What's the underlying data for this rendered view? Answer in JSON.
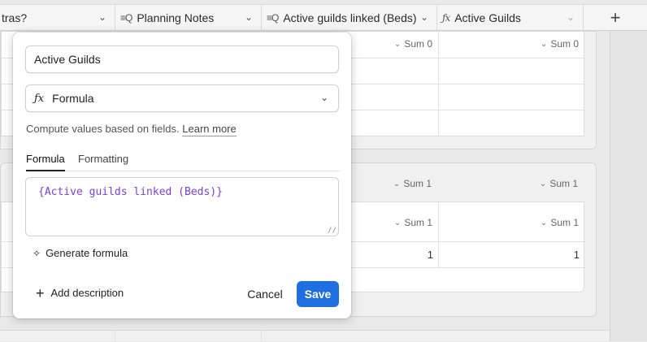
{
  "header": {
    "columns": [
      {
        "label": "tras?",
        "icon": "chevron-down-icon"
      },
      {
        "label": "Planning Notes",
        "icon": "lookup-icon"
      },
      {
        "label": "Active guilds linked (Beds)",
        "icon": "lookup-icon"
      },
      {
        "label": "Active Guilds",
        "icon": "formula-icon"
      }
    ],
    "add_column": "+"
  },
  "groups": [
    {
      "sums": [
        "Sum 0",
        "Sum 0"
      ]
    },
    {
      "sums": [
        "Sum 1",
        "Sum 1"
      ],
      "subsums": [
        "Sum 1",
        "Sum 1"
      ],
      "values": [
        "1",
        "1"
      ]
    }
  ],
  "sum_label": "Sum",
  "popup": {
    "name_value": "Active Guilds",
    "type_icon": "formula-icon",
    "type_label": "Formula",
    "helper_text": "Compute values based on fields.",
    "learn_more": "Learn more",
    "tabs": [
      "Formula",
      "Formatting"
    ],
    "formula": "{Active guilds linked (Beds)}",
    "generate_label": "Generate formula",
    "add_description": "Add description",
    "cancel": "Cancel",
    "save": "Save"
  },
  "colors": {
    "accent": "#1f6fe0",
    "formula_text": "#7b3fe4"
  }
}
